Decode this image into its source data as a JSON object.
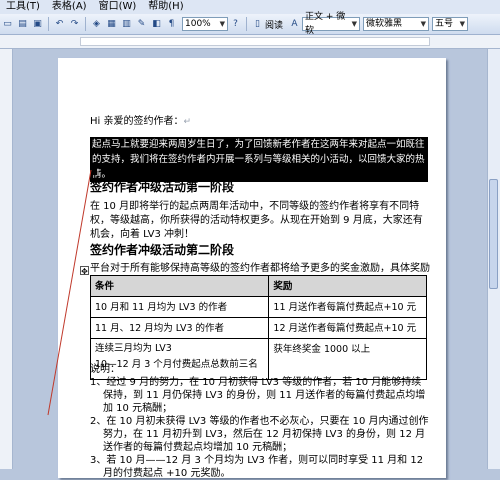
{
  "menu": [
    "工具(T)",
    "表格(A)",
    "窗口(W)",
    "帮助(H)"
  ],
  "toolbar": {
    "zoom": "100%",
    "read_label": "阅读",
    "style": "正文 + 微软",
    "font": "微软雅黑",
    "size": "五号"
  },
  "doc": {
    "greeting": "Hi 亲爱的签约作者：",
    "intro": "起点马上就要迎来两周岁生日了，为了回馈新老作者在这两年来对起点一如既往的支持，我们将在签约作者内开展一系列与等级相关的小活动，以回馈大家的热情。",
    "h1": "签约作者冲级活动第一阶段",
    "p1": "在 10 月即将举行的起点两周年活动中，不同等级的签约作者将享有不同特权，等级越高，你所获得的活动特权更多。从现在开始到 9 月底，大家还有机会，向着 LV3 冲刺！",
    "h2": "签约作者冲级活动第二阶段",
    "p2": "平台对于所有能够保持高等级的签约作者都将给予更多的奖金激励，具体奖励办法如下：",
    "table": {
      "headers": [
        "条件",
        "奖励"
      ],
      "rows": [
        [
          "10 月和 11 月均为 LV3 的作者",
          "11 月送作者每篇付费起点+10 元"
        ],
        [
          "11 月、12 月均为 LV3 的作者",
          "12 月送作者每篇付费起点+10 元"
        ],
        [
          "连续三月均为 LV3\n10—12 月 3 个月付费起点总数前三名",
          "获年终奖金 1000 以上"
        ]
      ]
    },
    "notes_title": "说明：",
    "notes": [
      "1、经过 9 月的努力，在 10 月初获得 LV3 等级的作者，若 10 月能够持续保持，到 11 月仍保持 LV3 的身份，则 11 月送作者的每篇付费起点均增加 10 元稿酬；",
      "2、在 10 月初未获得 LV3 等级的作者也不必灰心，只要在 10 月内通过创作努力，在 11 月初升到 LV3，然后在 12 月初保持 LV3 的身份，则 12 月送作者的每篇付费起点均增加 10 元稿酬；",
      "3、若 10 月——12 月 3 个月均为 LV3 作者，则可以同时享受 11 月和 12 月的付费起点 +10 元奖励。"
    ]
  }
}
